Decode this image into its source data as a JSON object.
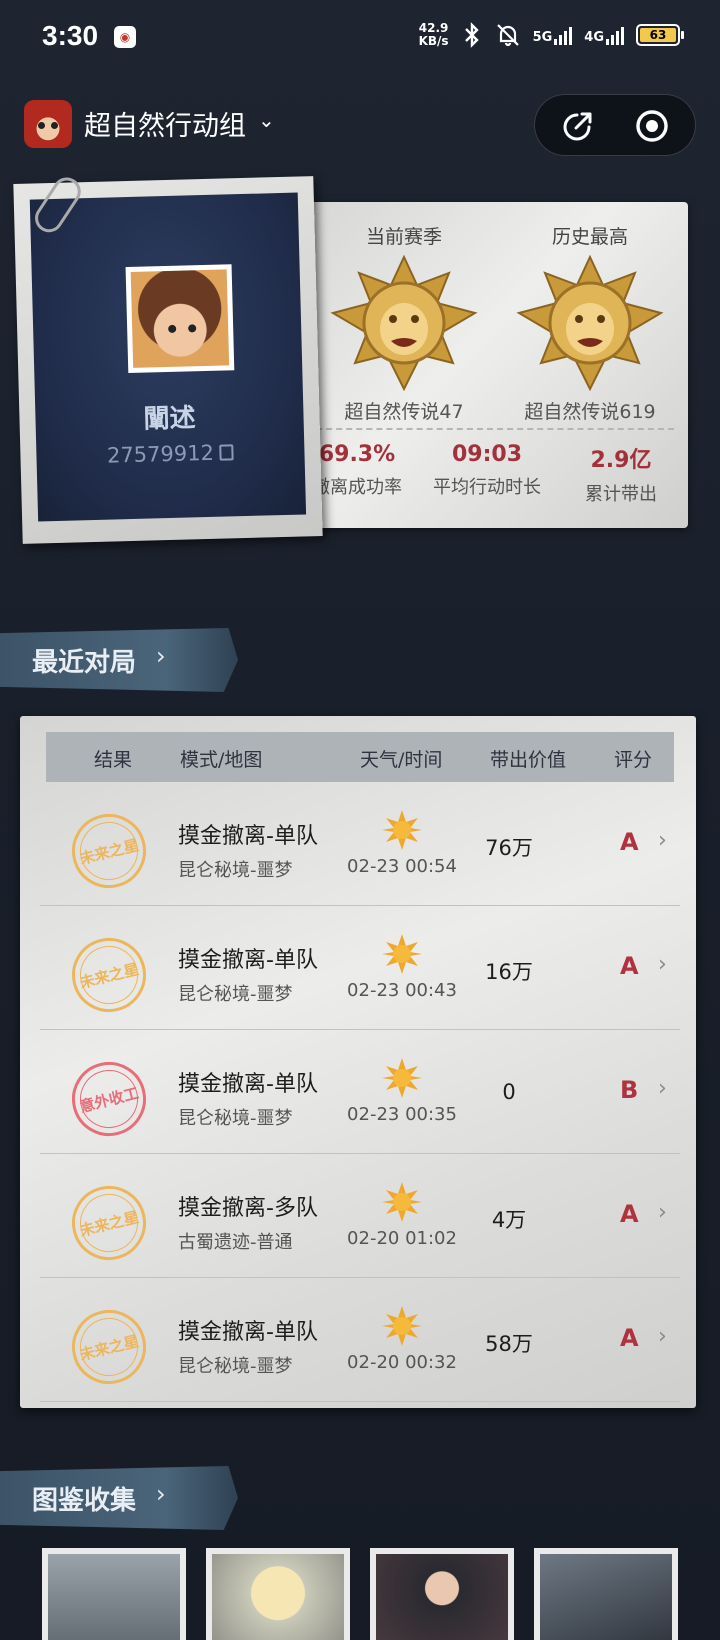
{
  "status_bar": {
    "time": "3:30",
    "net_speed_value": "42.9",
    "net_speed_unit": "KB/s",
    "sig1": "5G",
    "sig2": "4G",
    "battery": "63"
  },
  "header": {
    "team_name": "超自然行动组",
    "chevron": "⌄"
  },
  "profile": {
    "name": "闡述",
    "id": "27579912",
    "current_season_label": "当前赛季",
    "current_season_rank": "超自然传说47",
    "best_label": "历史最高",
    "best_rank": "超自然传说619",
    "stats": [
      {
        "value": "69.3%",
        "label": "撤离成功率"
      },
      {
        "value": "09:03",
        "label": "平均行动时长"
      },
      {
        "value": "2.9亿",
        "label": "累计带出"
      }
    ]
  },
  "recent": {
    "title": "最近对局",
    "chevron": "›",
    "columns": [
      "结果",
      "模式/地图",
      "天气/时间",
      "带出价值",
      "评分"
    ],
    "rows": [
      {
        "stamp": "未来之星",
        "mode": "摸金撤离-单队",
        "map": "昆仑秘境-噩梦",
        "time": "02-23 00:54",
        "value": "76万",
        "grade": "A"
      },
      {
        "stamp": "未来之星",
        "mode": "摸金撤离-单队",
        "map": "昆仑秘境-噩梦",
        "time": "02-23 00:43",
        "value": "16万",
        "grade": "A"
      },
      {
        "stamp": "意外收工",
        "mode": "摸金撤离-单队",
        "map": "昆仑秘境-噩梦",
        "time": "02-23 00:35",
        "value": "0",
        "grade": "B"
      },
      {
        "stamp": "未来之星",
        "mode": "摸金撤离-多队",
        "map": "古蜀遗迹-普通",
        "time": "02-20 01:02",
        "value": "4万",
        "grade": "A"
      },
      {
        "stamp": "未来之星",
        "mode": "摸金撤离-单队",
        "map": "昆仑秘境-噩梦",
        "time": "02-20 00:32",
        "value": "58万",
        "grade": "A"
      }
    ]
  },
  "collection": {
    "title": "图鉴收集",
    "chevron": "›"
  },
  "colors": {
    "accent_red": "#a3313b",
    "stamp_gold": "#ecb65c",
    "stamp_red": "#e86d78",
    "banner": "#4a6479"
  },
  "icons": [
    "share-icon",
    "record-icon",
    "copy-icon",
    "sun-icon",
    "chevron-right-icon",
    "bluetooth-icon",
    "bell-off-icon"
  ]
}
